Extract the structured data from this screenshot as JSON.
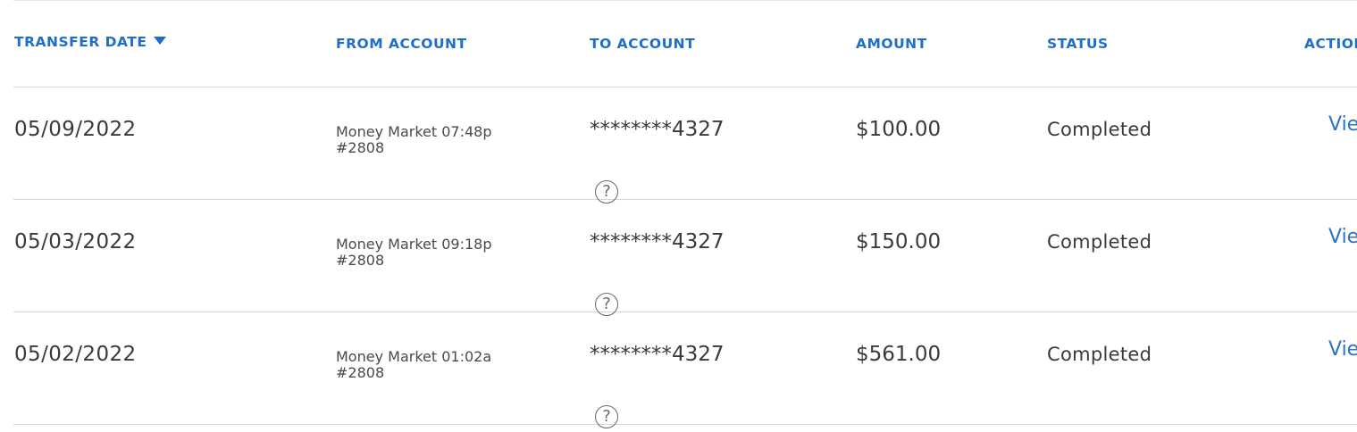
{
  "table": {
    "headers": {
      "transfer_date": "TRANSFER DATE",
      "from_account": "FROM ACCOUNT",
      "to_account": "TO ACCOUNT",
      "amount": "AMOUNT",
      "status": "STATUS",
      "actions": "ACTIONS"
    },
    "sort": {
      "column": "transfer_date",
      "direction": "descending",
      "icon": "caret-down-icon"
    },
    "help_icon_glyph": "?",
    "rows": [
      {
        "date": "05/09/2022",
        "from_line1": "Money Market 07:48p",
        "from_line2": "#2808",
        "to": "********4327",
        "amount": "$100.00",
        "status": "Completed",
        "action": "View"
      },
      {
        "date": "05/03/2022",
        "from_line1": "Money Market 09:18p",
        "from_line2": "#2808",
        "to": "********4327",
        "amount": "$150.00",
        "status": "Completed",
        "action": "View"
      },
      {
        "date": "05/02/2022",
        "from_line1": "Money Market 01:02a",
        "from_line2": "#2808",
        "to": "********4327",
        "amount": "$561.00",
        "status": "Completed",
        "action": "View"
      }
    ]
  },
  "colors": {
    "header_text": "#1f6fc9",
    "link": "#2a73c8",
    "row_divider": "#d7d7d7"
  }
}
